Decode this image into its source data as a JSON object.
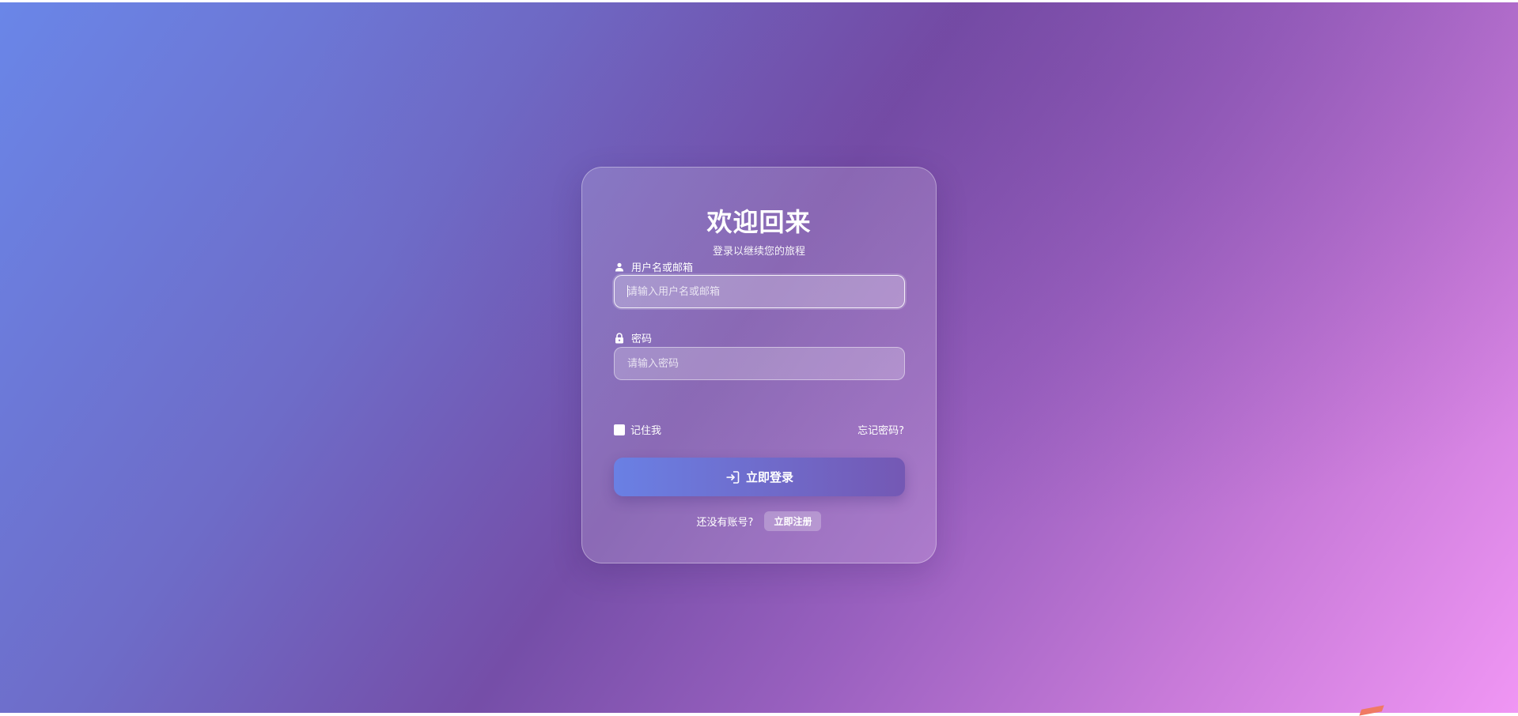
{
  "login": {
    "title": "欢迎回来",
    "subtitle": "登录以继续您的旅程",
    "username": {
      "label": "用户名或邮箱",
      "placeholder": "请输入用户名或邮箱",
      "value": "",
      "icon": "user-icon"
    },
    "password": {
      "label": "密码",
      "placeholder": "请输入密码",
      "value": "",
      "icon": "lock-icon"
    },
    "remember_label": "记住我",
    "remember_checked": false,
    "forgot_label": "忘记密码?",
    "submit_label": "立即登录",
    "submit_icon": "login-icon",
    "signup_prompt": "还没有账号?",
    "signup_label": "立即注册"
  },
  "colors": {
    "gradient_start": "#6a86e8",
    "gradient_mid": "#754ea8",
    "gradient_end": "#f096f4",
    "button_start": "#6a80e4",
    "button_end": "#7458b4"
  }
}
